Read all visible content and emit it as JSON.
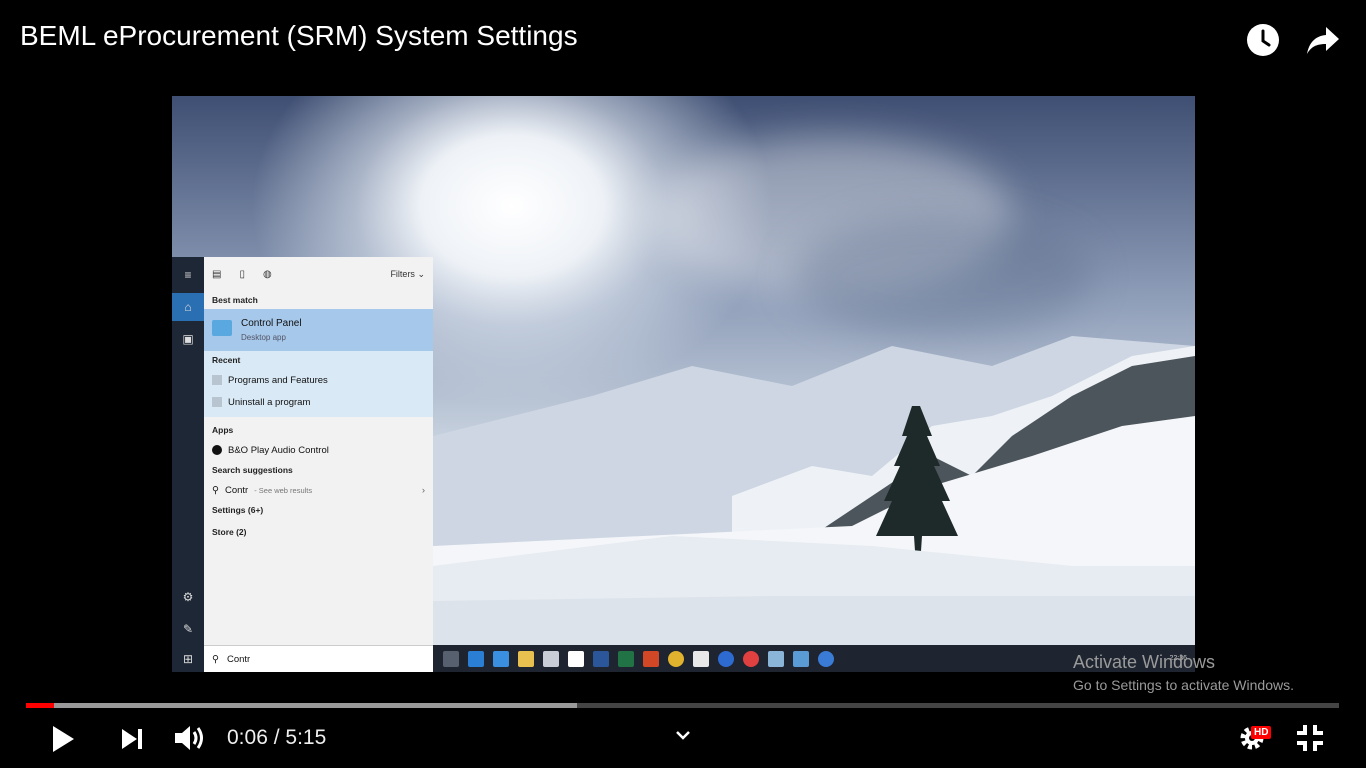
{
  "player": {
    "title": "BEML eProcurement (SRM) System Settings",
    "icons": {
      "watch_later": "clock-icon",
      "share": "share-arrow-icon"
    },
    "time_current": "0:06",
    "time_separator": " / ",
    "time_total": "5:15",
    "played_fraction": 0.021,
    "buffered_fraction": 0.42,
    "hd_badge": "HD",
    "accent": "#ff0000"
  },
  "windows": {
    "start_menu": {
      "filters_label": "Filters",
      "best_match_label": "Best match",
      "best_match": {
        "name": "Control Panel",
        "type": "Desktop app"
      },
      "recent_label": "Recent",
      "recent": [
        "Programs and Features",
        "Uninstall a program"
      ],
      "apps_label": "Apps",
      "apps": [
        "B&O Play Audio Control"
      ],
      "suggestions_label": "Search suggestions",
      "suggestion_query": "Contr",
      "suggestion_hint": " - See web results",
      "settings_label": "Settings (6+)",
      "store_label": "Store (2)",
      "search_value": "Contr"
    },
    "clock": "22:36",
    "watermark_title": "Activate Windows",
    "watermark_sub": "Go to Settings to activate Windows."
  }
}
